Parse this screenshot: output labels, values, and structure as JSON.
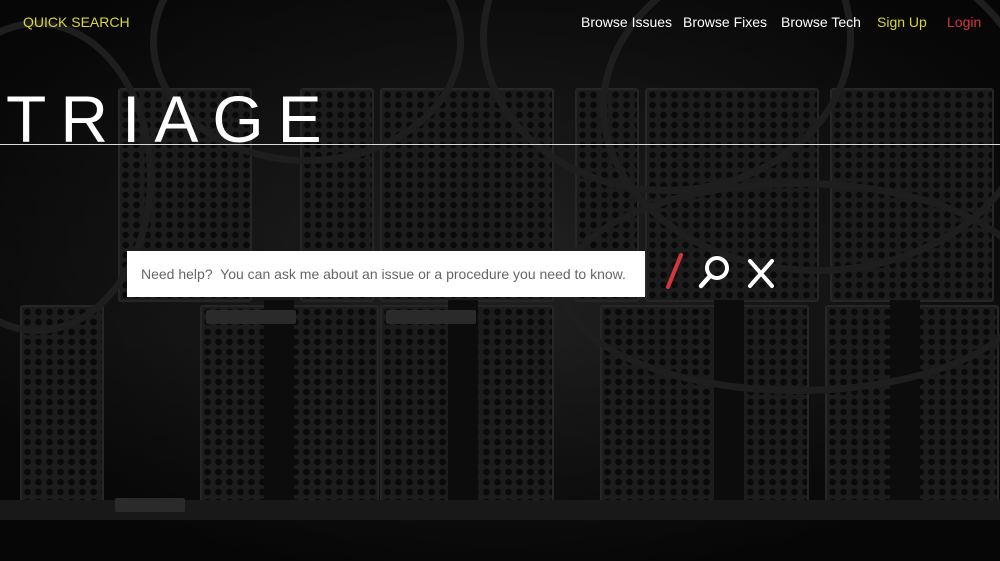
{
  "nav": {
    "quick_search": "QUICK SEARCH",
    "browse_issues": "Browse Issues",
    "browse_fixes": "Browse Fixes",
    "browse_tech": "Browse Tech",
    "sign_up": "Sign Up",
    "login": "Login"
  },
  "hero": {
    "logo": "TRIAGE"
  },
  "search": {
    "placeholder": "Need help?  You can ask me about an issue or a procedure you need to know.",
    "value": ""
  },
  "icons": {
    "divider": "slash-icon",
    "submit": "search-icon",
    "clear": "close-icon"
  },
  "colors": {
    "accent_yellow": "#d9d635",
    "accent_red": "#d4363d",
    "text": "#ffffff",
    "background": "#141414"
  }
}
